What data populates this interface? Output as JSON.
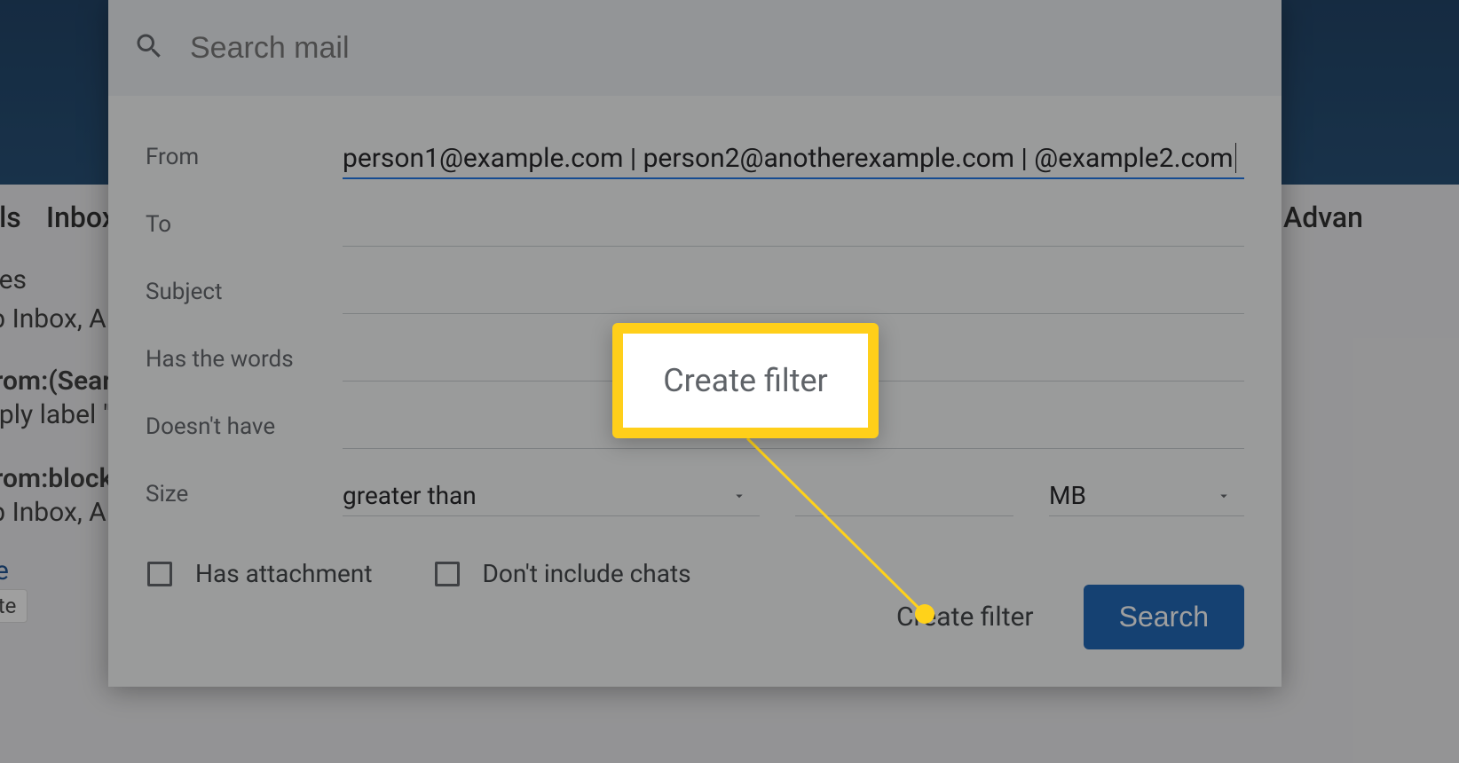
{
  "search": {
    "placeholder": "Search mail"
  },
  "fields": {
    "from_label": "From",
    "from_value": "person1@example.com | person2@anotherexample.com | @example2.com",
    "to_label": "To",
    "subject_label": "Subject",
    "haswords_label": "Has the words",
    "doesnthave_label": "Doesn't have",
    "size_label": "Size",
    "size_op": "greater than",
    "size_unit": "MB"
  },
  "checks": {
    "has_attachment": "Has attachment",
    "no_chats": "Don't include chats"
  },
  "actions": {
    "create_filter": "Create filter",
    "search": "Search"
  },
  "callout": {
    "text": "Create filter"
  },
  "background": {
    "tab_labels": "els",
    "tab_inbox": "Inbox",
    "tab_advanced": "Advan",
    "line_nes": "nes",
    "line_ipinbox": "ip Inbox, A",
    "line_fromsear": "from:(Sear",
    "line_applylabel": "pply label \"",
    "line_fromblock": "from:block",
    "line_ipinbox2": "ip Inbox, A",
    "link_e": "e",
    "btn_delete": "ete"
  }
}
